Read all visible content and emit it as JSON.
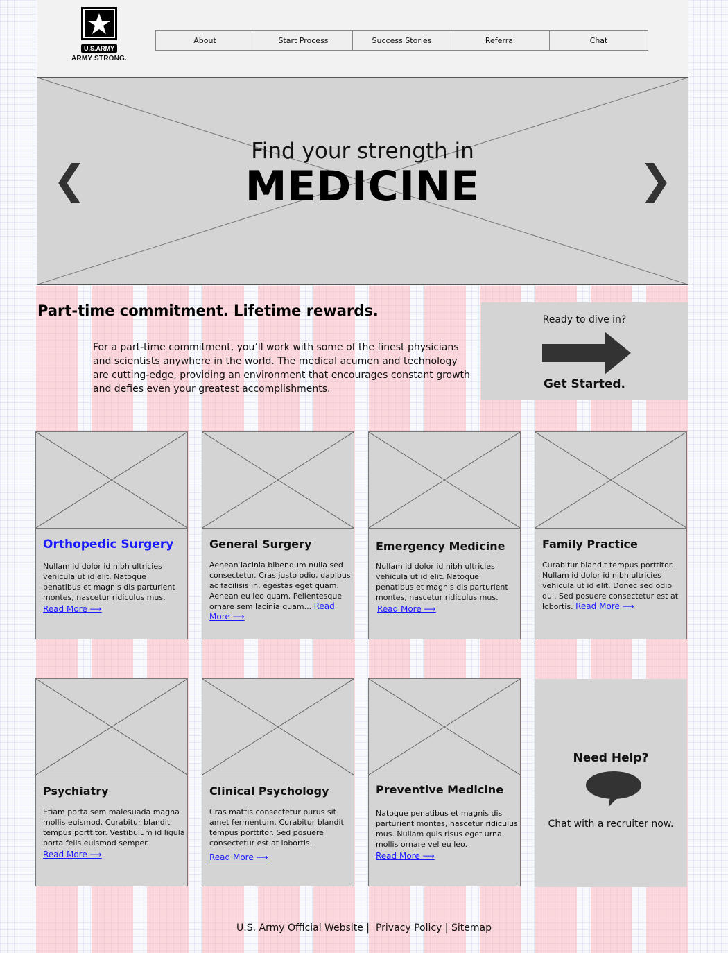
{
  "header": {
    "logo_tag": "U.S.ARMY",
    "logo_text": "ARMY STRONG.",
    "nav": [
      "About",
      "Start Process",
      "Success Stories",
      "Referral",
      "Chat"
    ]
  },
  "hero": {
    "subtitle": "Find your strength in",
    "title": "MEDICINE",
    "prev_icon": "chevron-left",
    "next_icon": "chevron-right"
  },
  "intro": {
    "tagline": "Part-time commitment. Lifetime rewards.",
    "text": "For a part-time commitment, you’ll work with some of the finest physicians and scientists anywhere in the world. The medical acumen and technology are cutting-edge, providing an environment that encourages constant growth and defies even your greatest accomplishments."
  },
  "cta": {
    "top": "Ready to dive in?",
    "bottom": "Get Started."
  },
  "cards": [
    {
      "title": "Orthopedic Surgery",
      "text": "Nullam id dolor id nibh ultricies vehicula ut id elit. Natoque penatibus et magnis dis parturient montes, nascetur ridiculus mus.",
      "link": "Read More ⟶"
    },
    {
      "title": "General Surgery",
      "text": "Aenean lacinia bibendum nulla sed consectetur. Cras justo odio, dapibus ac facilisis in, egestas eget quam. Aenean eu leo quam. Pellentesque ornare sem lacinia quam...",
      "link": "Read More ⟶"
    },
    {
      "title": "Emergency Medicine",
      "text": "Nullam id dolor id nibh ultricies vehicula ut id elit. Natoque penatibus et magnis dis parturient montes, nascetur ridiculus mus.",
      "link": "Read More ⟶"
    },
    {
      "title": "Family Practice",
      "text": "Curabitur blandit tempus porttitor. Nullam id dolor id nibh ultricies vehicula ut id elit. Donec sed odio dui. Sed posuere consectetur est at lobortis.",
      "link": "Read More ⟶"
    },
    {
      "title": "Psychiatry",
      "text": "Etiam porta sem malesuada magna mollis euismod. Curabitur blandit tempus porttitor. Vestibulum id ligula porta felis euismod semper.",
      "link": "Read More ⟶"
    },
    {
      "title": "Clinical Psychology",
      "text": "Cras mattis consectetur purus sit amet fermentum. Curabitur blandit tempus porttitor. Sed posuere consectetur est at lobortis.",
      "link": "Read More ⟶"
    },
    {
      "title": "Preventive Medicine",
      "text": "Natoque penatibus et magnis dis parturient montes, nascetur ridiculus mus. Nullam quis risus eget urna mollis ornare vel eu leo.",
      "link": "Read More ⟶"
    }
  ],
  "help": {
    "title": "Need Help?",
    "text": "Chat with a recruiter now."
  },
  "footer": {
    "official": "U.S. Army Official Website",
    "sep1": " |  ",
    "privacy": "Privacy Policy",
    "sep2": " | ",
    "sitemap": "Sitemap"
  },
  "colors": {
    "placeholder": "#d4d4d4",
    "link": "#1a1aff",
    "guide": "#ffaaaf"
  }
}
